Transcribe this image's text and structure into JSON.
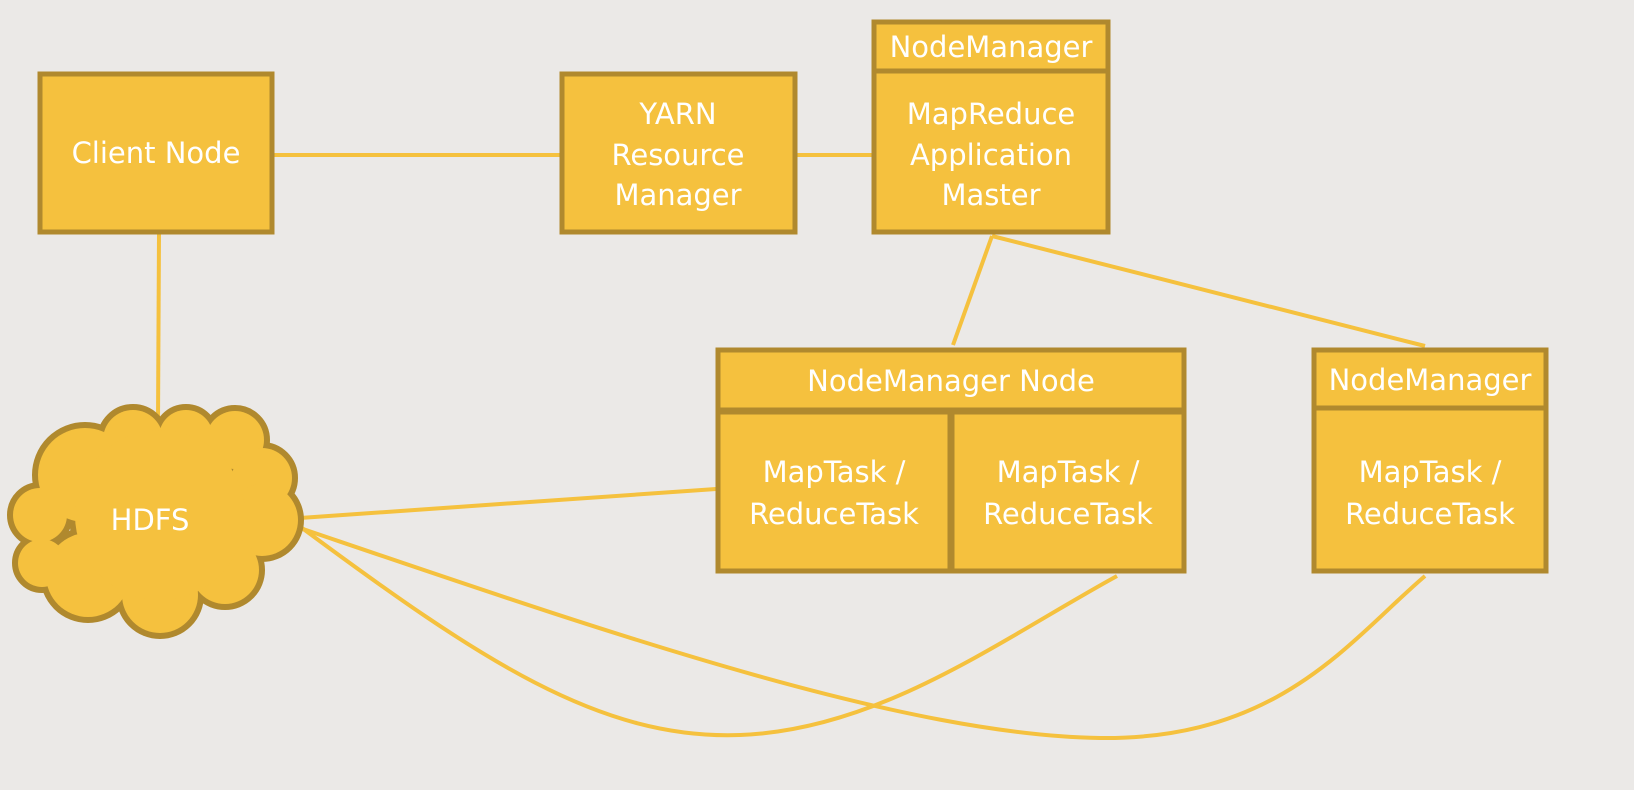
{
  "colors": {
    "node_fill": "#f5c13e",
    "node_stroke": "#b0892e",
    "edge": "#f5c13e",
    "background": "#ebe9e7",
    "text": "#ffffff"
  },
  "nodes": {
    "client": [
      "Client Node"
    ],
    "yarn": [
      "YARN",
      "Resource",
      "Manager"
    ],
    "am_header": "NodeManager",
    "am": [
      "MapReduce",
      "Application",
      "Master"
    ],
    "nm_node_header": "NodeManager Node",
    "task1": [
      "MapTask /",
      "ReduceTask"
    ],
    "task2": [
      "MapTask /",
      "ReduceTask"
    ],
    "nm_right_header": "NodeManager",
    "task3": [
      "MapTask /",
      "ReduceTask"
    ],
    "hdfs": "HDFS"
  }
}
